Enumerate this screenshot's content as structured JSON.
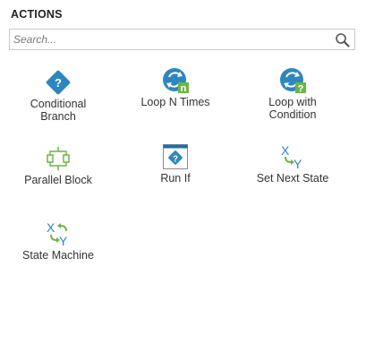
{
  "panel": {
    "title": "ACTIONS"
  },
  "search": {
    "placeholder": "Search...",
    "value": ""
  },
  "actions": [
    {
      "label": "Conditional\nBranch",
      "icon": "conditional-branch-icon"
    },
    {
      "label": "Loop N Times",
      "icon": "loop-n-times-icon"
    },
    {
      "label": "Loop with\nCondition",
      "icon": "loop-with-condition-icon"
    },
    {
      "label": "Parallel Block",
      "icon": "parallel-block-icon"
    },
    {
      "label": "Run If",
      "icon": "run-if-icon"
    },
    {
      "label": "Set Next State",
      "icon": "set-next-state-icon"
    },
    {
      "label": "State Machine",
      "icon": "state-machine-icon"
    }
  ],
  "colors": {
    "blue": "#2e86c1",
    "green": "#6cb644",
    "border": "#c9c9c9"
  }
}
